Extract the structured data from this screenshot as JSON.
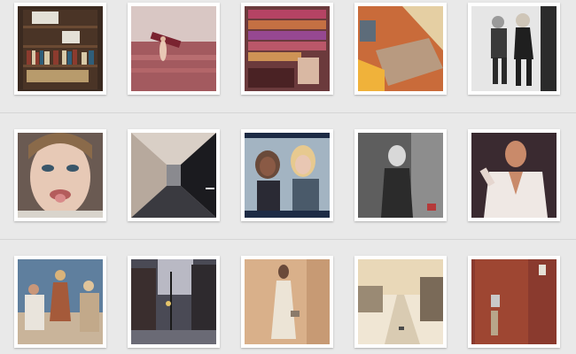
{
  "grid": {
    "photos": [
      {
        "id": "bookshelf-photo"
      },
      {
        "id": "beach-surfboard-photo"
      },
      {
        "id": "candy-store-photo"
      },
      {
        "id": "room-interior-photo"
      },
      {
        "id": "couple-bw-photo"
      },
      {
        "id": "tongue-out-selfie-photo"
      },
      {
        "id": "hallway-photo"
      },
      {
        "id": "two-women-photo"
      },
      {
        "id": "woman-bw-portrait-photo"
      },
      {
        "id": "white-robe-photo"
      },
      {
        "id": "fashion-group-photo"
      },
      {
        "id": "city-street-dusk-photo"
      },
      {
        "id": "woman-white-dress-photo"
      },
      {
        "id": "snowy-street-photo"
      },
      {
        "id": "red-door-photo"
      }
    ]
  }
}
